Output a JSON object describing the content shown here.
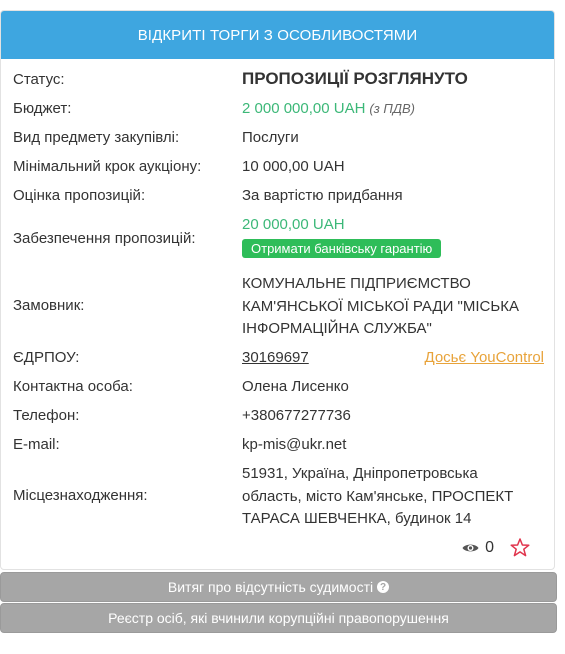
{
  "header": {
    "title": "ВІДКРИТІ ТОРГИ З ОСОБЛИВОСТЯМИ"
  },
  "rows": {
    "status": {
      "label": "Статус:",
      "value": "ПРОПОЗИЦІЇ РОЗГЛЯНУТО"
    },
    "budget": {
      "label": "Бюджет:",
      "value": "2 000 000,00 UAH",
      "note": "(з ПДВ)"
    },
    "subject_type": {
      "label": "Вид предмету закупівлі:",
      "value": "Послуги"
    },
    "min_step": {
      "label": "Мінімальний крок аукціону:",
      "value": "10 000,00 UAH"
    },
    "evaluation": {
      "label": "Оцінка пропозицій:",
      "value": "За вартістю придбання"
    },
    "security": {
      "label": "Забезпечення пропозицій:",
      "value": "20 000,00 UAH",
      "badge": "Отримати банківську гарантію"
    },
    "customer": {
      "label": "Замовник:",
      "line1": "КОМУНАЛЬНЕ ПІДПРИЄМСТВО",
      "line2": "КАМ'ЯНСЬКОЇ МІСЬКОЇ РАДИ \"МІСЬКА",
      "line3": "ІНФОРМАЦІЙНА СЛУЖБА\""
    },
    "edrpou": {
      "label": "ЄДРПОУ:",
      "value": "30169697",
      "link": "Досьє YouControl"
    },
    "contact": {
      "label": "Контактна особа:",
      "value": "Олена Лисенко"
    },
    "phone": {
      "label": "Телефон:",
      "value": "+380677277736"
    },
    "email": {
      "label": "E-mail:",
      "value": "kp-mis@ukr.net"
    },
    "location": {
      "label": "Місцезнаходження:",
      "line1": "51931, Україна, Дніпропетровська",
      "line2": "область, місто Кам'янське, ПРОСПЕКТ",
      "line3": "ТАРАСА ШЕВЧЕНКА, будинок 14"
    }
  },
  "meta": {
    "views": "0",
    "icons": [
      "eye-icon",
      "star-icon"
    ]
  },
  "buttons": {
    "criminal": "Витяг про відсутність судимості",
    "corruption": "Реєстр осіб, які вчинили корупційні правопорушення"
  },
  "colors": {
    "header": "#3ea6e0",
    "green": "#3cb878",
    "badge": "#2ebd59",
    "link": "#e8a33a",
    "star": "#e0334c",
    "grey_button": "#a6a6a6"
  }
}
